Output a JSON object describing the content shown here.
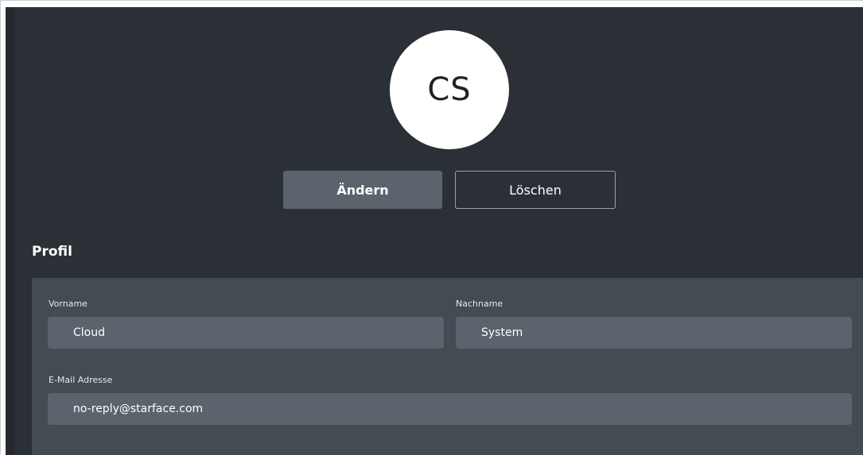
{
  "avatar": {
    "initials": "CS"
  },
  "actions": {
    "change_label": "Ändern",
    "delete_label": "Löschen"
  },
  "profile": {
    "title": "Profil",
    "first_name": {
      "label": "Vorname",
      "value": "Cloud"
    },
    "last_name": {
      "label": "Nachname",
      "value": "System"
    },
    "email": {
      "label": "E-Mail Adresse",
      "value": "no-reply@starface.com"
    }
  },
  "colors": {
    "background": "#2b3037",
    "panel": "#444b53",
    "input": "#5b636c",
    "primary_button": "#5b636c",
    "avatar_bg": "#ffffff"
  }
}
